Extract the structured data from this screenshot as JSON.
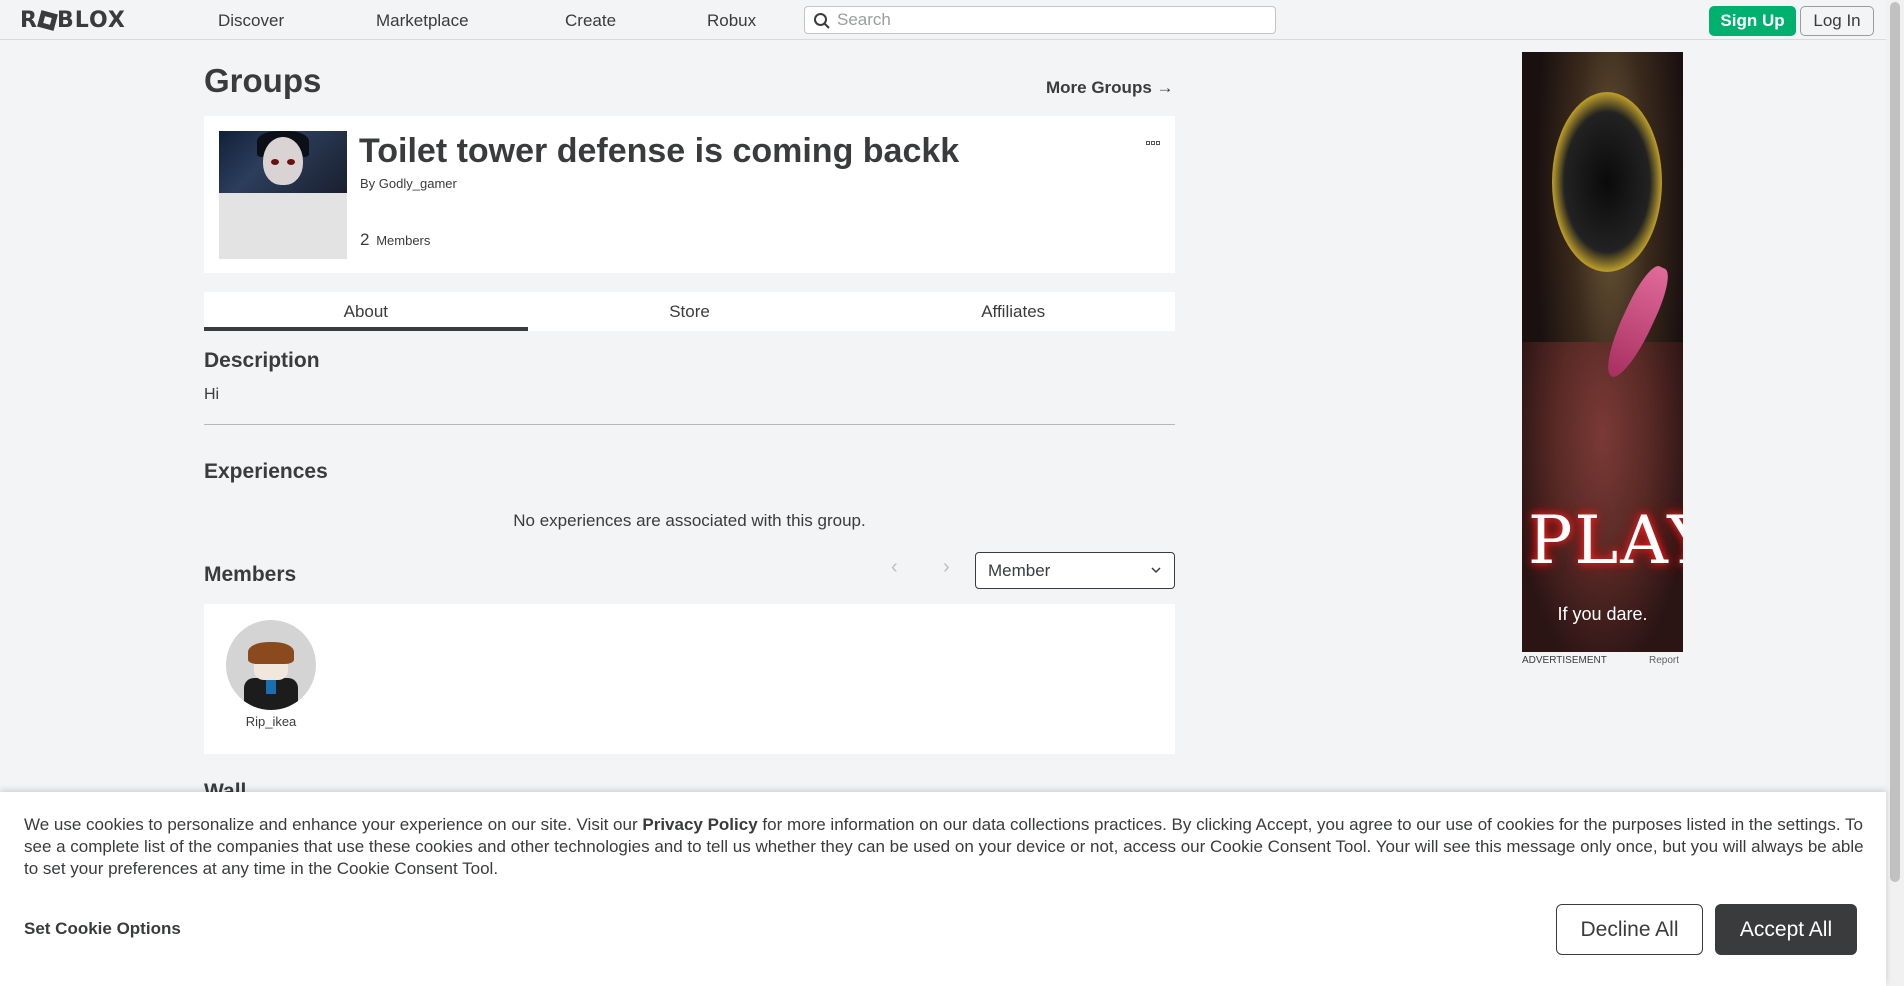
{
  "header": {
    "logo": "ROBLOX",
    "nav": [
      "Discover",
      "Marketplace",
      "Create",
      "Robux"
    ],
    "search_placeholder": "Search",
    "signup_label": "Sign Up",
    "login_label": "Log In"
  },
  "page": {
    "title": "Groups",
    "more_groups": "More Groups →"
  },
  "group": {
    "name": "Toilet tower defense is coming backk",
    "by_prefix": "By",
    "owner": "Godly_gamer",
    "member_count": "2",
    "members_label": "Members"
  },
  "tabs": [
    {
      "label": "About",
      "active": true
    },
    {
      "label": "Store",
      "active": false
    },
    {
      "label": "Affiliates",
      "active": false
    }
  ],
  "about": {
    "description_heading": "Description",
    "description": "Hi",
    "experiences_heading": "Experiences",
    "no_experiences": "No experiences are associated with this group.",
    "members_heading": "Members",
    "role_selected": "Member",
    "members": [
      {
        "name": "Rip_ikea",
        "avatar": "avatar-icon"
      }
    ],
    "wall_heading": "Wall"
  },
  "ad": {
    "headline": "PLAY",
    "tagline": "If you dare.",
    "label": "ADVERTISEMENT",
    "report": "Report"
  },
  "cookie": {
    "text_before": "We use cookies to personalize and enhance your experience on our site. Visit our ",
    "privacy_link": "Privacy Policy",
    "text_after": " for more information on our data collections practices. By clicking Accept, you agree to our use of cookies for the purposes listed in the settings. To see a complete list of the companies that use these cookies and other technologies and to tell us whether they can be used on your device or not, access our Cookie Consent Tool. Your will see this message only once, but you will always be able to set your preferences at any time in the Cookie Consent Tool.",
    "set_options": "Set Cookie Options",
    "decline": "Decline All",
    "accept": "Accept All"
  },
  "colors": {
    "signup_green": "#00b06f",
    "page_bg": "#f2f4f5",
    "text_dark": "#393b3d"
  }
}
